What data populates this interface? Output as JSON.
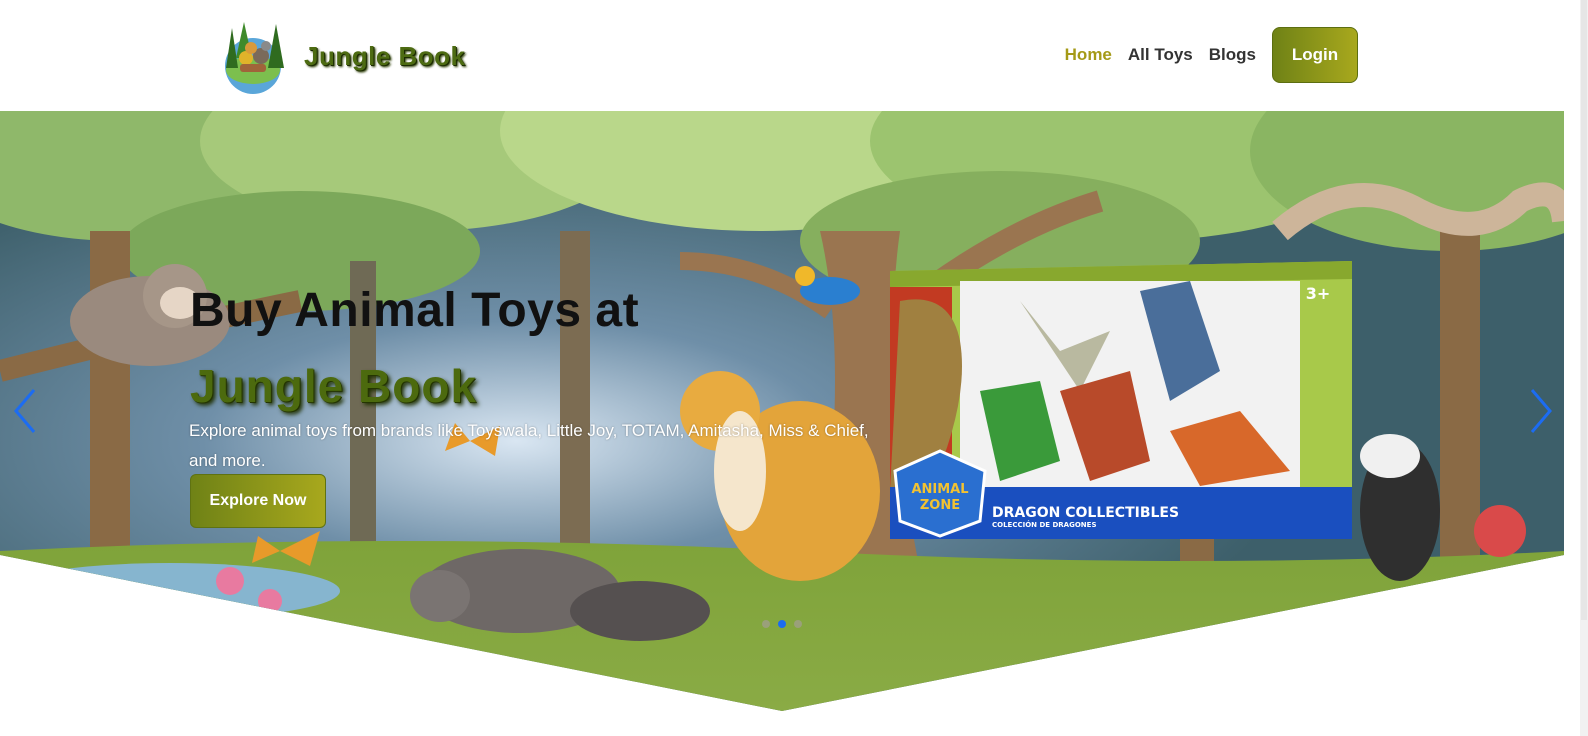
{
  "header": {
    "brand_name": "Jungle Book",
    "nav": [
      {
        "label": "Home",
        "active": true
      },
      {
        "label": "All Toys",
        "active": false
      },
      {
        "label": "Blogs",
        "active": false
      }
    ],
    "login_label": "Login"
  },
  "hero": {
    "title": "Buy Animal Toys at",
    "brand": "Jungle Book",
    "description": "Explore animal toys from brands like Toyswala, Little Joy, TOTAM, Amitasha, Miss & Chief, and more.",
    "cta_label": "Explore Now",
    "product": {
      "badge": "3+",
      "logo_line1": "ANIMAL",
      "logo_line2": "ZONE",
      "title": "DRAGON COLLECTIBLES",
      "subtitle": "COLECCIÓN DE DRAGONES"
    },
    "carousel": {
      "slide_count": 3,
      "active_index": 1
    }
  },
  "colors": {
    "accent": "#a59a17",
    "button_gradient_start": "#6f8216",
    "button_gradient_end": "#a8a81d",
    "brand_text": "#4c6a0e",
    "dot_active": "#1c6cf2"
  },
  "icons": {
    "prev": "chevron-left-icon",
    "next": "chevron-right-icon"
  }
}
